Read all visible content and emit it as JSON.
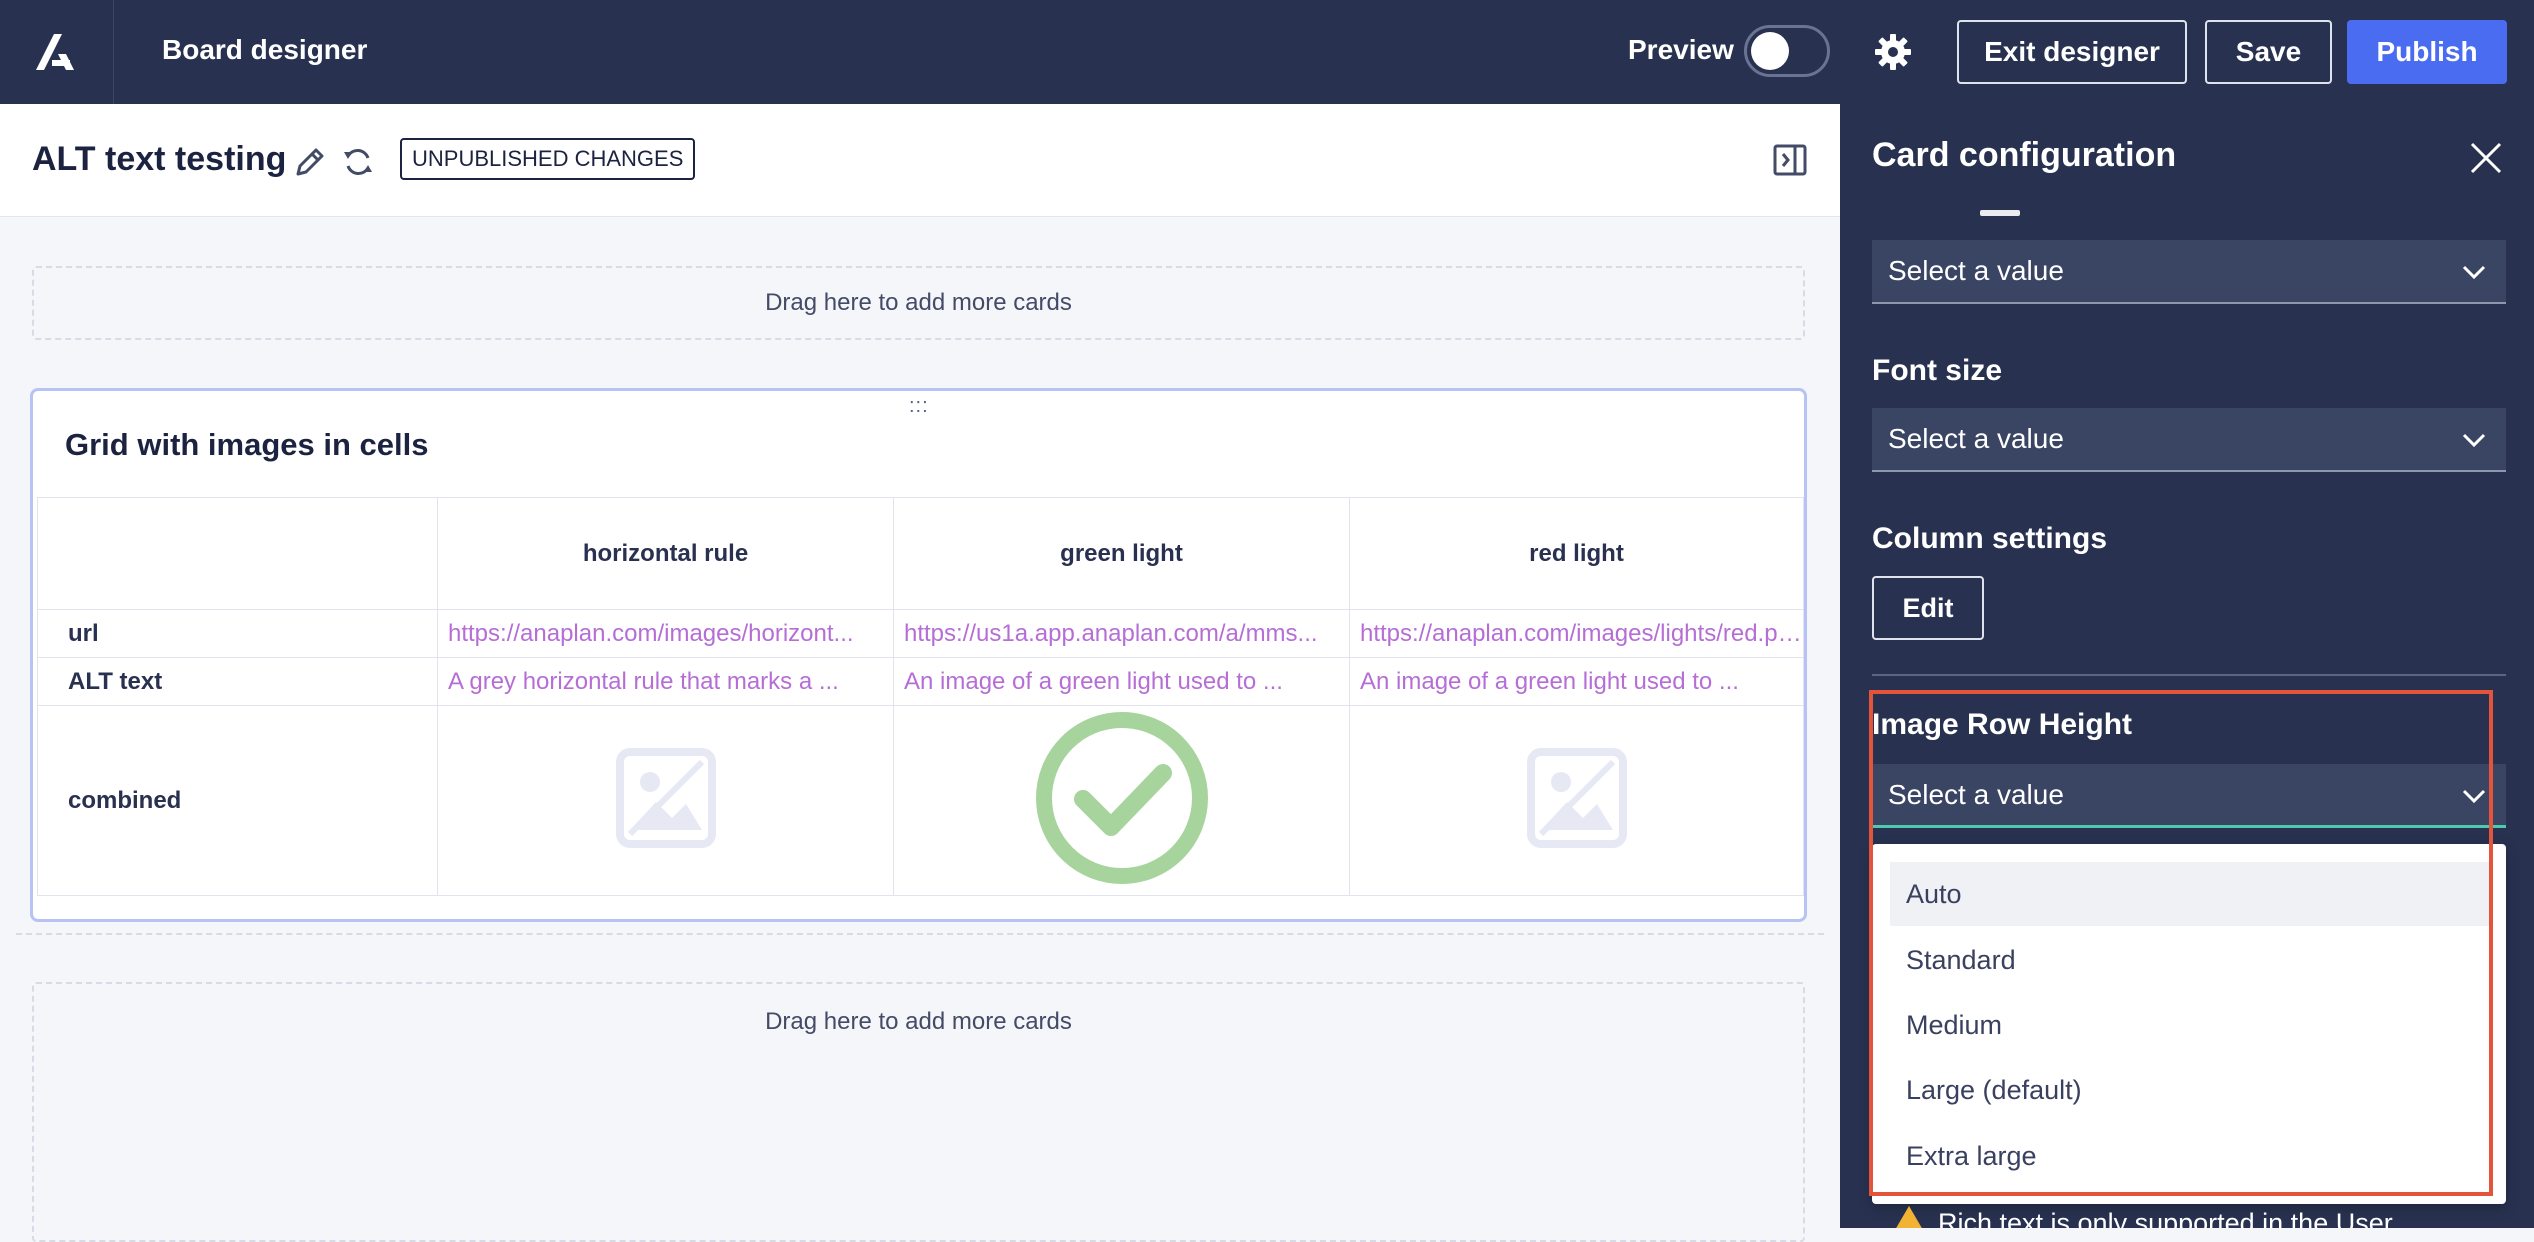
{
  "topbar": {
    "app_title": "Board designer",
    "preview_label": "Preview",
    "exit_label": "Exit designer",
    "save_label": "Save",
    "publish_label": "Publish"
  },
  "board": {
    "title": "ALT text testing",
    "badge": "UNPUBLISHED CHANGES",
    "dropzone_top": "Drag here to add more cards",
    "dropzone_bottom": "Drag here to add more cards"
  },
  "card": {
    "drag_handle": ":::",
    "title": "Grid with images in cells",
    "columns": [
      "horizontal rule",
      "green light",
      "red light"
    ],
    "rows": [
      {
        "label": "url",
        "cells": [
          "https://anaplan.com/images/horizont...",
          "https://us1a.app.anaplan.com/a/mms...",
          "https://anaplan.com/images/lights/red.png"
        ]
      },
      {
        "label": "ALT text",
        "cells": [
          "A grey horizontal rule that marks a ...",
          "An image of a green light used to ...",
          "An image of a green light used to ..."
        ]
      },
      {
        "label": "combined",
        "cells": [
          "",
          "",
          ""
        ]
      }
    ]
  },
  "panel": {
    "title": "Card configuration",
    "top_select": "Select a value",
    "font_size_label": "Font size",
    "font_size_select": "Select a value",
    "column_settings_label": "Column settings",
    "edit_label": "Edit",
    "image_row_height_label": "Image Row Height",
    "image_row_height_select": "Select a value",
    "options": [
      "Auto",
      "Standard",
      "Medium",
      "Large (default)",
      "Extra large"
    ],
    "bottom_hint": "Rich text is only supported in the User"
  },
  "colors": {
    "topbar_bg": "#283250",
    "accent_blue": "#4a6cf0",
    "link_purple": "#b66ed6",
    "highlight_red": "#e4543a",
    "focus_teal": "#4fc9b0",
    "check_green": "#a7d39c"
  }
}
